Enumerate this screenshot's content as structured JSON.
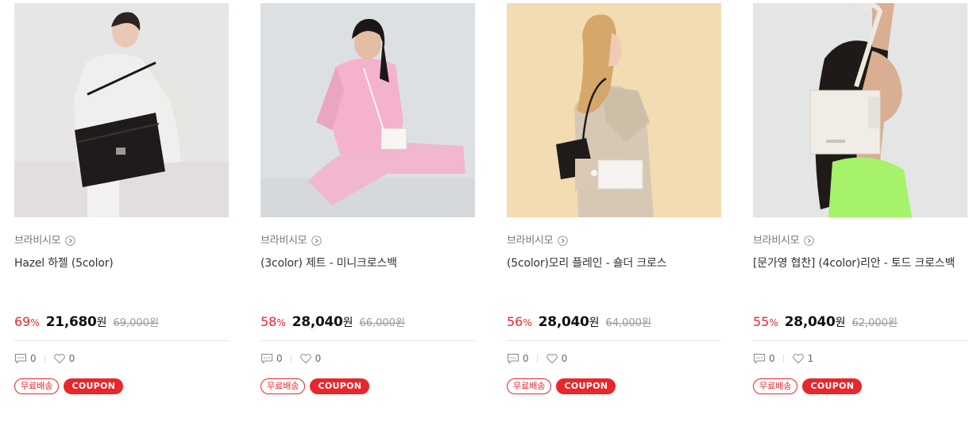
{
  "products": [
    {
      "brand": "브라비시모",
      "name": "Hazel 하젤 (5color)",
      "discount": "69",
      "discount_unit": "%",
      "price": "21,680",
      "price_unit": "원",
      "original_price": "69,000원",
      "reviews": "0",
      "likes": "0",
      "badge_free": "무료배송",
      "badge_coupon": "COUPON",
      "image": "model-with-black-shoulder-bag"
    },
    {
      "brand": "브라비시모",
      "name": "(3color) 제트 - 미니크로스백",
      "discount": "58",
      "discount_unit": "%",
      "price": "28,040",
      "price_unit": "원",
      "original_price": "66,000원",
      "reviews": "0",
      "likes": "0",
      "badge_free": "무료배송",
      "badge_coupon": "COUPON",
      "image": "model-in-pink-with-white-mini-bag"
    },
    {
      "brand": "브라비시모",
      "name": "(5color)모리 플레인 - 숄더 크로스",
      "discount": "56",
      "discount_unit": "%",
      "price": "28,040",
      "price_unit": "원",
      "original_price": "64,000원",
      "reviews": "0",
      "likes": "0",
      "badge_free": "무료배송",
      "badge_coupon": "COUPON",
      "image": "model-profile-with-shoulder-bags"
    },
    {
      "brand": "브라비시모",
      "name": "[문가영 협찬] (4color)리안 - 토드 크로스백",
      "discount": "55",
      "discount_unit": "%",
      "price": "28,040",
      "price_unit": "원",
      "original_price": "62,000원",
      "reviews": "0",
      "likes": "1",
      "badge_free": "무료배송",
      "badge_coupon": "COUPON",
      "image": "model-holding-white-tote-bag"
    }
  ],
  "colors": {
    "accent": "#e8262c",
    "muted": "#999999",
    "divider": "#e5e5e5"
  }
}
